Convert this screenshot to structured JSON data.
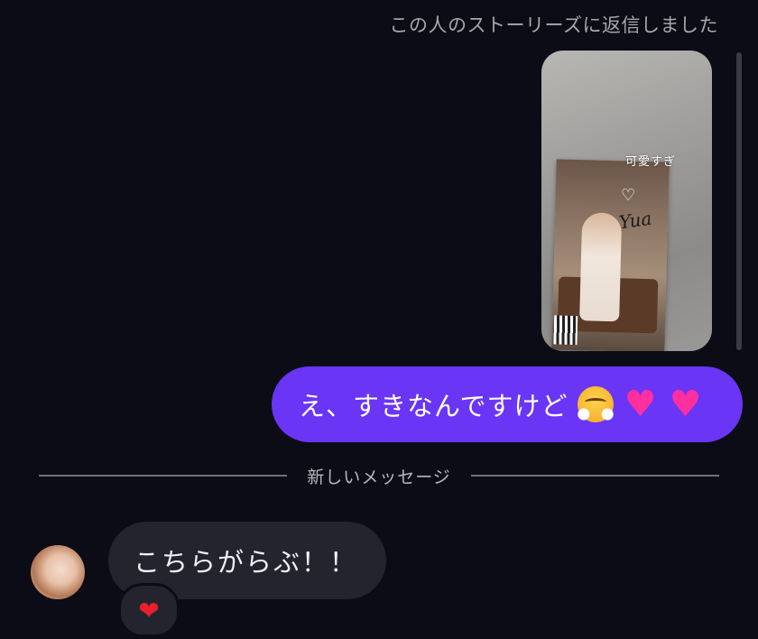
{
  "story_reply": {
    "caption": "この人のストーリーズに返信しました",
    "sticker_text": "可愛すぎ",
    "signature": "Yua"
  },
  "sent_message": {
    "text": "え、すきなんですけど",
    "emojis": [
      "face-with-steam-from-nose",
      "pink-heart",
      "pink-heart"
    ]
  },
  "divider": {
    "label": "新しいメッセージ"
  },
  "received_message": {
    "text": "こちらがらぶ！！",
    "reaction": "red-heart"
  },
  "colors": {
    "background": "#0b0c16",
    "sent_bubble": "#6a35f5",
    "received_bubble": "#23242e",
    "reaction_heart": "#e8202b",
    "pink_heart": "#ff2fa0"
  }
}
